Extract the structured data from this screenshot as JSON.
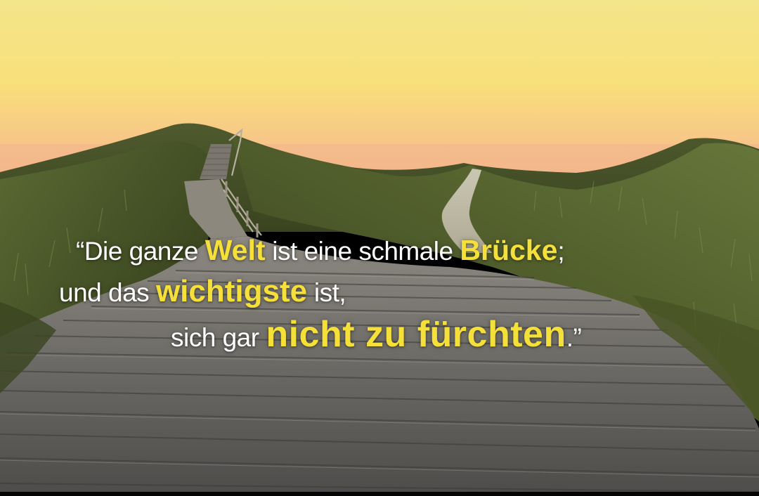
{
  "quote": {
    "line1": {
      "pre": "“Die ganze ",
      "em1": "Welt",
      "mid": " ist eine schmale ",
      "em2": "Brücke",
      "post": ";"
    },
    "line2": {
      "pre": "und das ",
      "em": "wichtigste",
      "post": " ist,"
    },
    "line3": {
      "pre": "sich gar ",
      "em": "nicht zu fürchten",
      "post": ".”"
    }
  },
  "colors": {
    "highlight": "#f5e03a",
    "text": "#ffffff",
    "sky_top": "#f6e27a",
    "sky_horizon": "#f7c27a",
    "grass": "#4d5a2c",
    "boardwalk": "#6e6c68"
  }
}
